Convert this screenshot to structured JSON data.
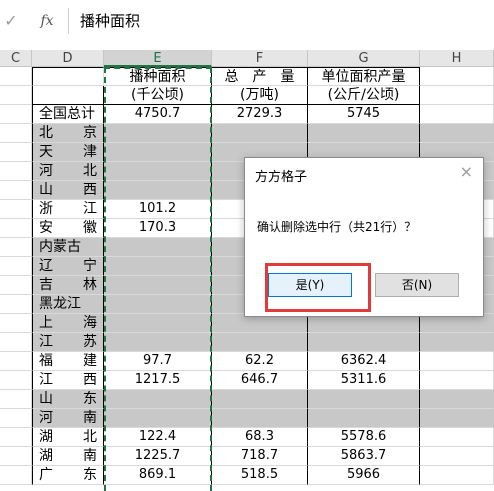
{
  "formula_bar": {
    "check": "✓",
    "fx": "fx",
    "content": "播种面积"
  },
  "columns": [
    {
      "id": "C",
      "label": "C"
    },
    {
      "id": "D",
      "label": "D"
    },
    {
      "id": "E",
      "label": "E"
    },
    {
      "id": "F",
      "label": "F"
    },
    {
      "id": "G",
      "label": "G"
    },
    {
      "id": "H",
      "label": "H"
    }
  ],
  "headers": {
    "e1": "播种面积",
    "e2": "(千公顷)",
    "f1": "总　产　量",
    "f2": "(万吨)",
    "g1": "单位面积产量",
    "g2": "(公斤/公顷)"
  },
  "rows": [
    {
      "name": "全国总计",
      "e": "4750.7",
      "f": "2729.3",
      "g": "5745",
      "gray": false
    },
    {
      "name": "北京",
      "e": "",
      "f": "",
      "g": "",
      "gray": true
    },
    {
      "name": "天津",
      "e": "",
      "f": "",
      "g": "",
      "gray": true
    },
    {
      "name": "河北",
      "e": "",
      "f": "",
      "g": "",
      "gray": true
    },
    {
      "name": "山西",
      "e": "",
      "f": "",
      "g": "",
      "gray": true
    },
    {
      "name": "浙江",
      "e": "101.2",
      "f": "",
      "g": "",
      "gray": false
    },
    {
      "name": "安徽",
      "e": "170.3",
      "f": "",
      "g": "",
      "gray": false
    },
    {
      "name": "内蒙古",
      "e": "",
      "f": "",
      "g": "",
      "gray": true
    },
    {
      "name": "辽宁",
      "e": "",
      "f": "",
      "g": "",
      "gray": true
    },
    {
      "name": "吉林",
      "e": "",
      "f": "",
      "g": "",
      "gray": true
    },
    {
      "name": "黑龙江",
      "e": "",
      "f": "",
      "g": "",
      "gray": true
    },
    {
      "name": "上海",
      "e": "",
      "f": "",
      "g": "",
      "gray": true
    },
    {
      "name": "江苏",
      "e": "",
      "f": "",
      "g": "",
      "gray": true
    },
    {
      "name": "福建",
      "e": "97.7",
      "f": "62.2",
      "g": "6362.4",
      "gray": false
    },
    {
      "name": "江西",
      "e": "1217.5",
      "f": "646.7",
      "g": "5311.6",
      "gray": false
    },
    {
      "name": "山东",
      "e": "",
      "f": "",
      "g": "",
      "gray": true
    },
    {
      "name": "河南",
      "e": "",
      "f": "",
      "g": "",
      "gray": true
    },
    {
      "name": "湖北",
      "e": "122.4",
      "f": "68.3",
      "g": "5578.6",
      "gray": false
    },
    {
      "name": "湖南",
      "e": "1225.7",
      "f": "718.7",
      "g": "5863.7",
      "gray": false
    },
    {
      "name": "广东",
      "e": "869.1",
      "f": "518.5",
      "g": "5966",
      "gray": false
    }
  ],
  "dialog": {
    "title": "方方格子",
    "close": "×",
    "message": "确认删除选中行（共21行）？",
    "yes": "是(Y)",
    "no": "否(N)"
  }
}
